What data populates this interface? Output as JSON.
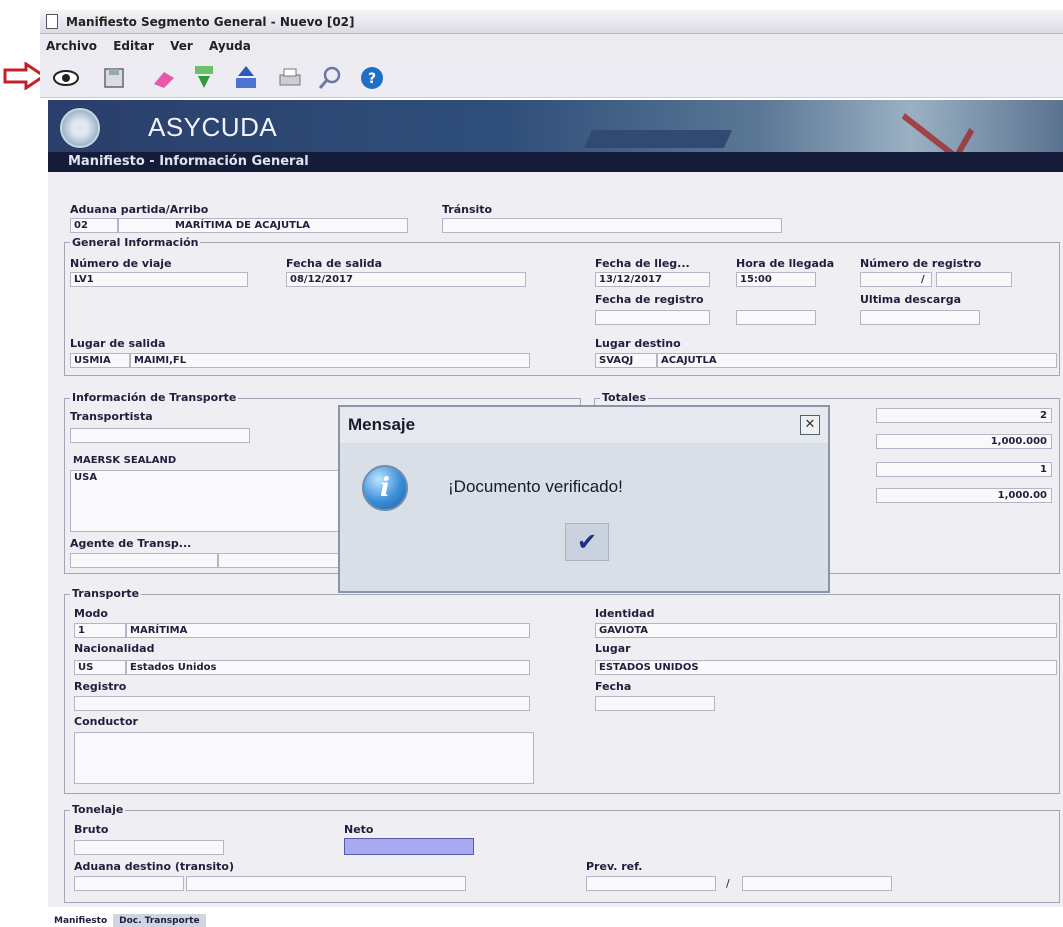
{
  "window": {
    "title": "Manifiesto Segmento General - Nuevo [02]"
  },
  "menu": [
    "Archivo",
    "Editar",
    "Ver",
    "Ayuda"
  ],
  "toolbar": {
    "icons": [
      "view-icon",
      "save-icon",
      "delete-icon",
      "download-icon",
      "upload-xml-icon",
      "print-icon",
      "search-icon",
      "help-icon"
    ]
  },
  "banner": {
    "brand": "ASYCUDA",
    "section": "Manifiesto - Información General"
  },
  "aduana": {
    "label": "Aduana partida/Arribo",
    "code": "02",
    "name": "MARÍTIMA DE ACAJUTLA"
  },
  "transito": {
    "label": "Tránsito",
    "value": ""
  },
  "general": {
    "title": "General Información",
    "viaje_label": "Número de viaje",
    "viaje": "LV1",
    "salida_label": "Fecha de salida",
    "salida": "08/12/2017",
    "llegada_label": "Fecha de lleg...",
    "llegada": "13/12/2017",
    "hora_label": "Hora de llegada",
    "hora": "15:00",
    "registro_label": "Número de registro",
    "registro_sep": "/",
    "fecha_registro_label": "Fecha de registro",
    "ultima_label": "Ultima descarga",
    "lugar_salida_label": "Lugar de salida",
    "lugar_salida_code": "USMIA",
    "lugar_salida_name": "MAIMI,FL",
    "lugar_destino_label": "Lugar destino",
    "lugar_destino_code": "SVAQJ",
    "lugar_destino_name": "ACAJUTLA"
  },
  "transporte_info": {
    "title": "Información de Transporte",
    "transportista_label": "Transportista",
    "transportista_name": "MAERSK SEALAND",
    "transportista_country": "USA",
    "agente_label": "Agente de Transp..."
  },
  "totales": {
    "title": "Totales",
    "values": [
      "2",
      "1,000.000",
      "1",
      "1,000.00"
    ]
  },
  "dialog": {
    "title": "Mensaje",
    "message": "¡Documento verificado!",
    "close_glyph": "✕",
    "ok_glyph": "✔"
  },
  "transporte": {
    "title": "Transporte",
    "modo_label": "Modo",
    "modo_code": "1",
    "modo_name": "MARÍTIMA",
    "nacionalidad_label": "Nacionalidad",
    "nac_code": "US",
    "nac_name": "Estados Unidos",
    "registro_label": "Registro",
    "conductor_label": "Conductor",
    "identidad_label": "Identidad",
    "identidad": "GAVIOTA",
    "lugar_label": "Lugar",
    "lugar": "ESTADOS UNIDOS",
    "fecha_label": "Fecha"
  },
  "tonelaje": {
    "title": "Tonelaje",
    "bruto_label": "Bruto",
    "neto_label": "Neto",
    "aduana_destino_label": "Aduana destino (transito)",
    "prev_label": "Prev. ref.",
    "prev_sep": "/"
  },
  "tabs": [
    "Manifiesto",
    "Doc. Transporte"
  ],
  "colors": {
    "annotation_arrow": "#c4202a",
    "banner": "#2a3f6a",
    "selected_field": "#a9a9f2"
  }
}
